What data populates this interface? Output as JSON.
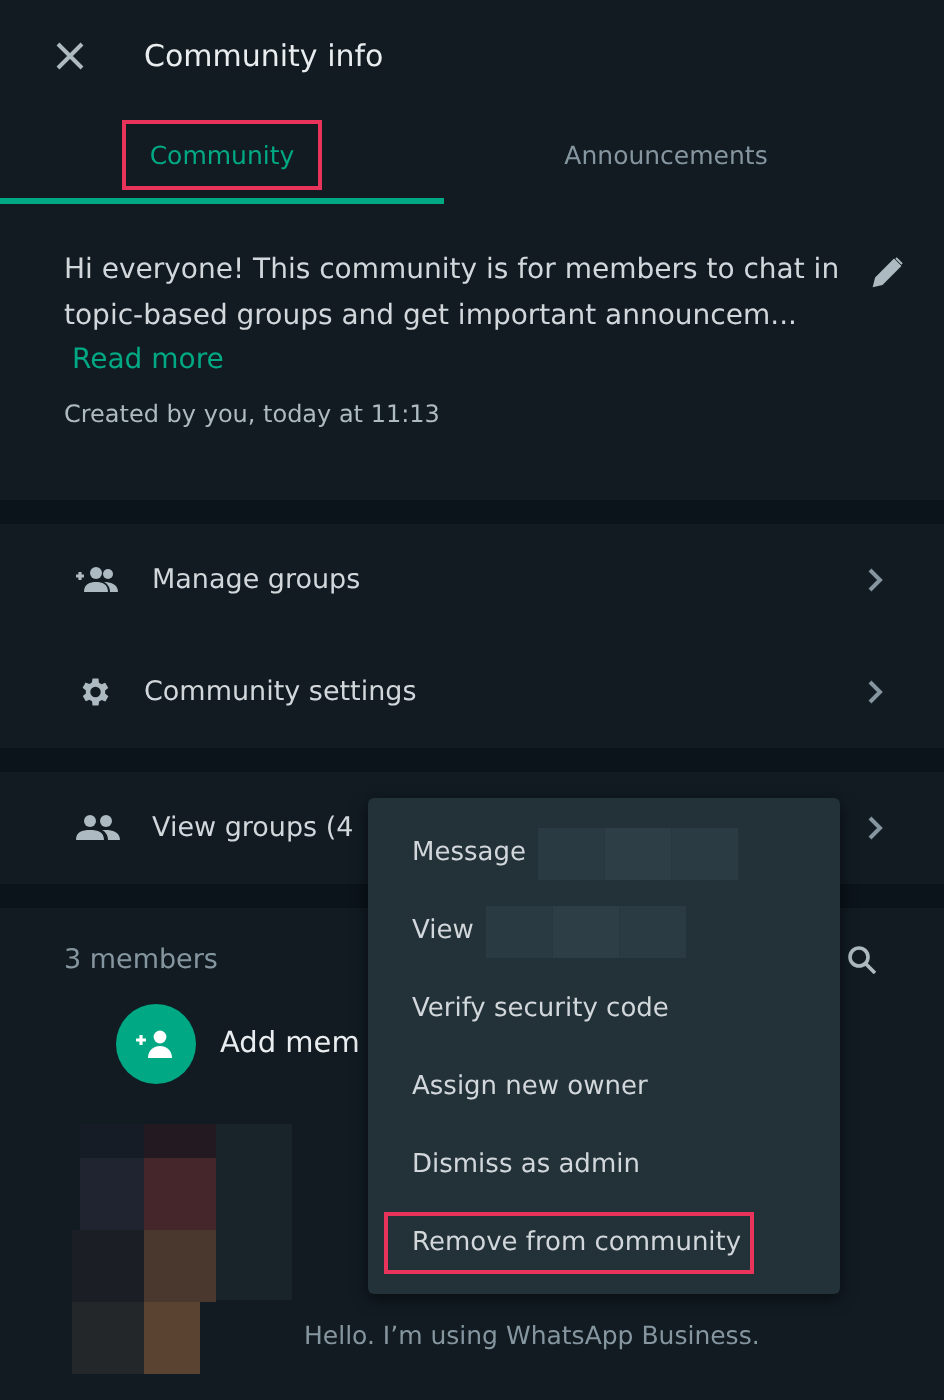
{
  "header": {
    "title": "Community info"
  },
  "tabs": [
    {
      "label": "Community",
      "selected": true,
      "highlighted": true
    },
    {
      "label": "Announcements",
      "selected": false,
      "highlighted": false
    }
  ],
  "description": {
    "text": "Hi everyone! This community is for members to chat in topic-based groups and get important announcem...",
    "link": "Read more",
    "created": "Created by you, today at 11:13"
  },
  "actions": [
    {
      "kind": "manage",
      "label": "Manage groups"
    },
    {
      "kind": "settings",
      "label": "Community settings"
    }
  ],
  "groups": {
    "label": "View groups (4"
  },
  "members": {
    "count": "3 members",
    "add_label": "Add mem",
    "status": "Hello. I’m using WhatsApp Business."
  },
  "menu": [
    {
      "label": "Message",
      "redacted": true,
      "highlighted": false
    },
    {
      "label": "View",
      "redacted": true,
      "highlighted": false
    },
    {
      "label": "Verify security code",
      "redacted": false,
      "highlighted": false
    },
    {
      "label": "Assign new owner",
      "redacted": false,
      "highlighted": false
    },
    {
      "label": "Dismiss as admin",
      "redacted": false,
      "highlighted": false
    },
    {
      "label": "Remove from community",
      "redacted": false,
      "highlighted": true
    }
  ]
}
